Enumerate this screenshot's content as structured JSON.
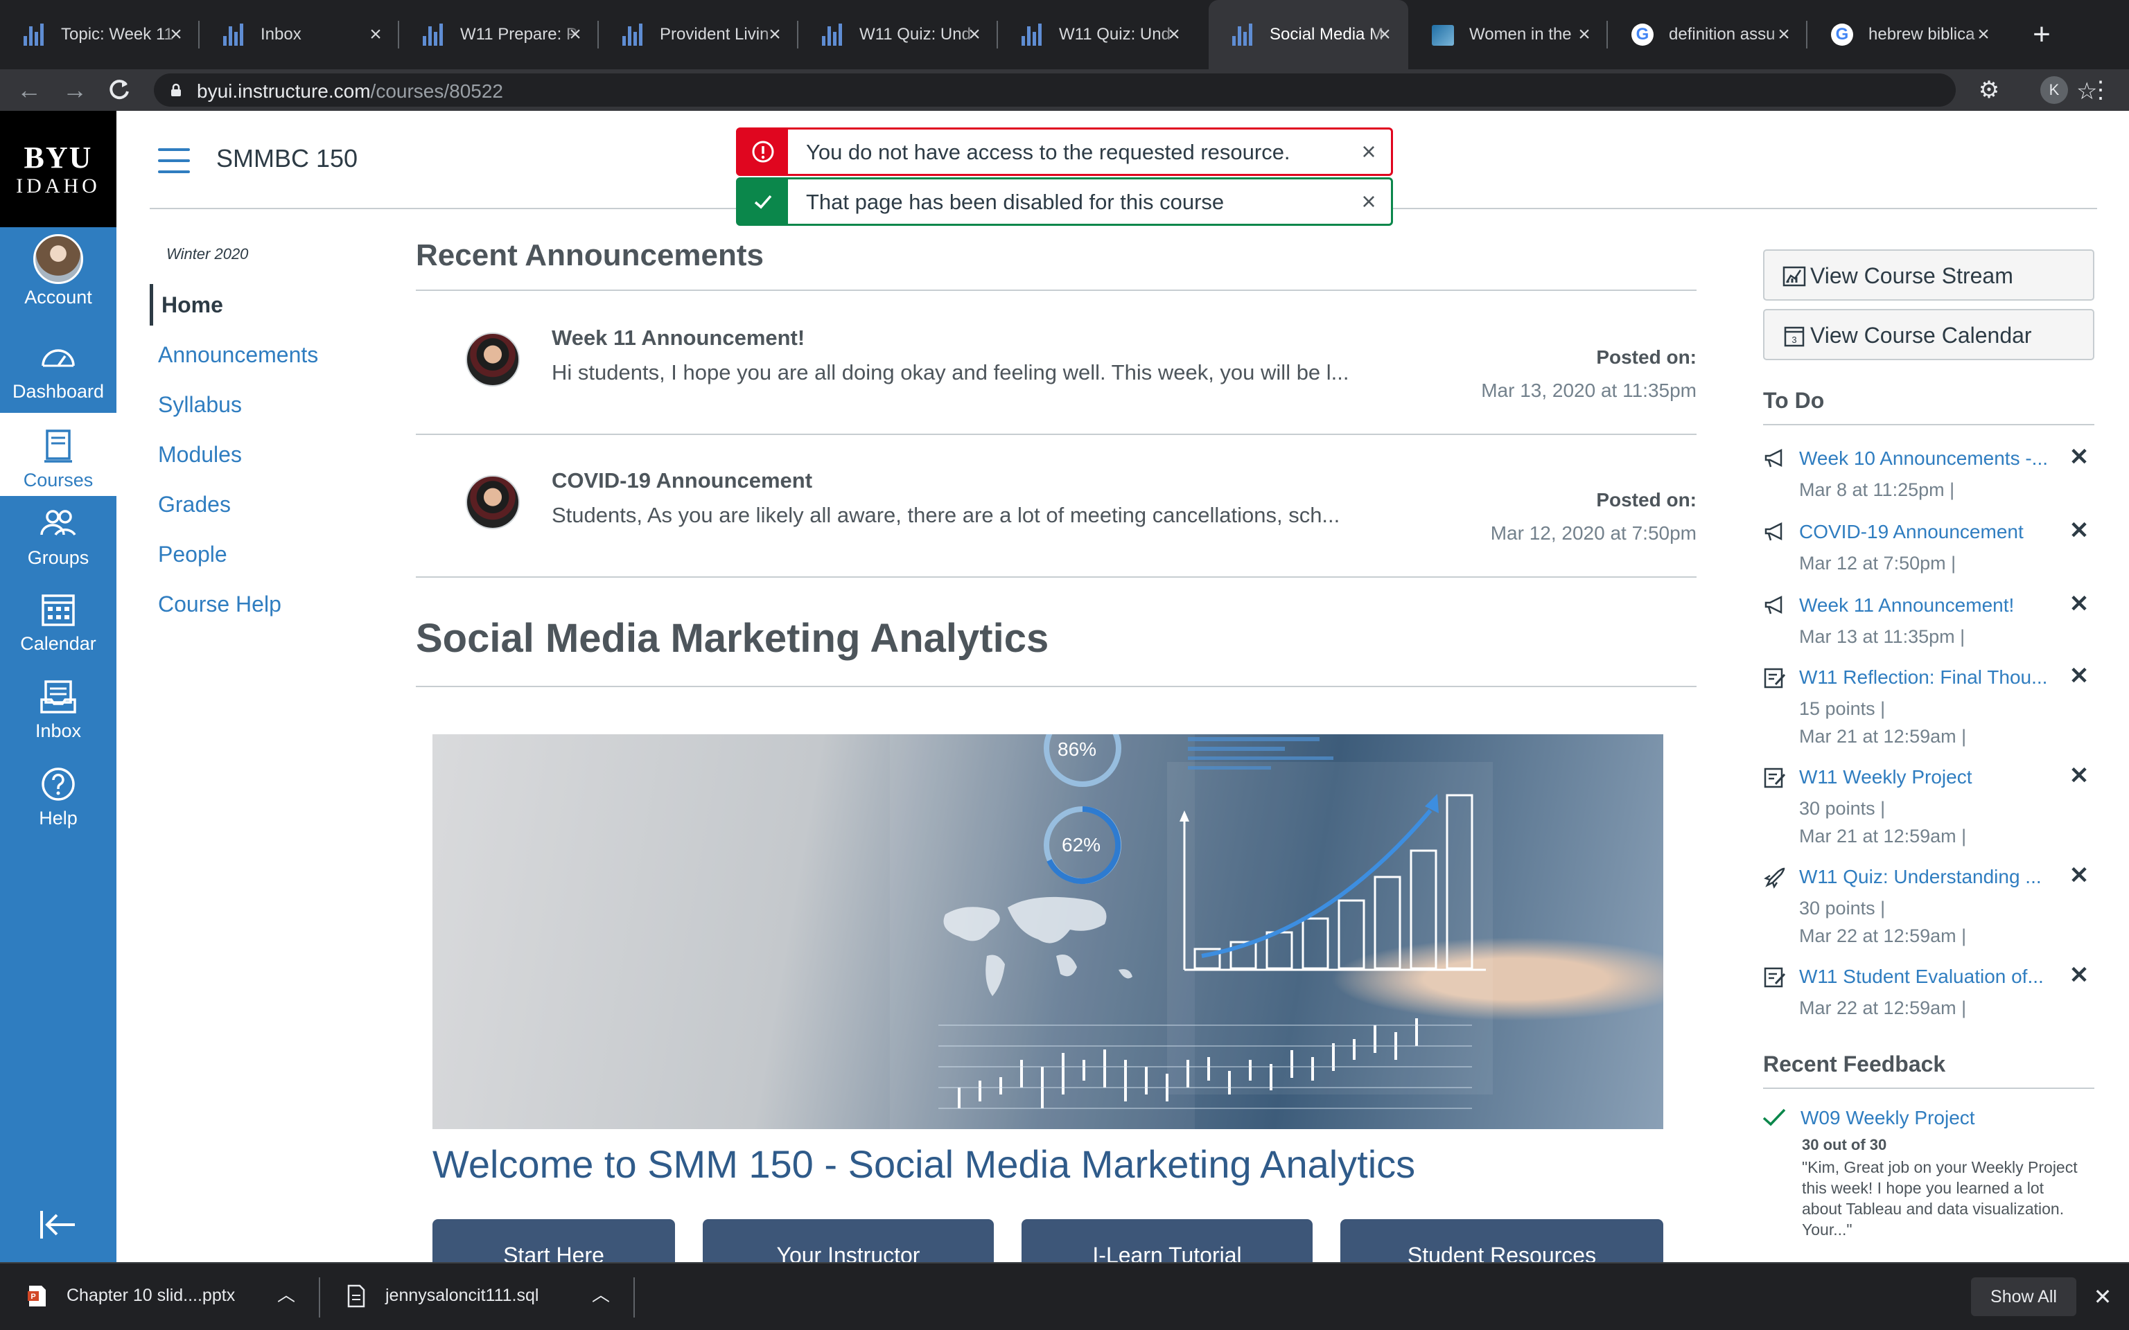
{
  "browser": {
    "tabs": [
      {
        "title": "Topic: Week 11",
        "icon": "canvas-icon"
      },
      {
        "title": "Inbox",
        "icon": "canvas-icon"
      },
      {
        "title": "W11 Prepare: P",
        "icon": "canvas-icon"
      },
      {
        "title": "Provident Livin",
        "icon": "canvas-icon"
      },
      {
        "title": "W11 Quiz: Und",
        "icon": "canvas-icon"
      },
      {
        "title": "W11 Quiz: Und",
        "icon": "canvas-icon"
      },
      {
        "title": "Social Media M",
        "icon": "canvas-icon",
        "active": true
      },
      {
        "title": "Women in the",
        "icon": "image-icon"
      },
      {
        "title": "definition assu",
        "icon": "google-icon"
      },
      {
        "title": "hebrew biblica",
        "icon": "google-icon"
      }
    ],
    "url_host": "byui.instructure.com",
    "url_path": "/courses/80522",
    "profile_initial": "K"
  },
  "global_nav": {
    "logo_line1": "BYU",
    "logo_line2": "IDAHO",
    "items": [
      {
        "label": "Account",
        "icon": "avatar"
      },
      {
        "label": "Dashboard",
        "icon": "dashboard-icon"
      },
      {
        "label": "Courses",
        "icon": "courses-icon",
        "active": true
      },
      {
        "label": "Groups",
        "icon": "groups-icon"
      },
      {
        "label": "Calendar",
        "icon": "calendar-icon"
      },
      {
        "label": "Inbox",
        "icon": "inbox-icon"
      },
      {
        "label": "Help",
        "icon": "help-icon"
      }
    ]
  },
  "course": {
    "code": "SMMBC 150",
    "term": "Winter 2020",
    "nav": [
      "Home",
      "Announcements",
      "Syllabus",
      "Modules",
      "Grades",
      "People",
      "Course Help"
    ]
  },
  "flash": {
    "error": "You do not have access to the requested resource.",
    "success": "That page has been disabled for this course"
  },
  "announcements": {
    "heading": "Recent Announcements",
    "posted_label": "Posted on:",
    "items": [
      {
        "title": "Week 11 Announcement!",
        "message": "Hi students,  I hope you are all doing okay and feeling well. This week, you will be l...",
        "date": "Mar 13, 2020 at 11:35pm"
      },
      {
        "title": "COVID-19 Announcement",
        "message": "Students,  As you are likely all aware, there are a lot of meeting cancellations, sch...",
        "date": "Mar 12, 2020 at 7:50pm"
      }
    ]
  },
  "main": {
    "course_heading": "Social Media Marketing Analytics",
    "banner_stats": [
      "86%",
      "62%"
    ],
    "welcome": "Welcome to SMM 150 - Social Media Marketing Analytics",
    "buttons": [
      "Start Here",
      "Your Instructor",
      "I-Learn Tutorial",
      "Student Resources"
    ]
  },
  "sidebar": {
    "view_stream": "View Course Stream",
    "view_calendar": "View Course Calendar",
    "todo_heading": "To Do",
    "todo": [
      {
        "title": "Week 10 Announcements -...",
        "type": "announcement",
        "meta": [
          "Mar 8 at 11:25pm  |"
        ]
      },
      {
        "title": "COVID-19 Announcement",
        "type": "announcement",
        "meta": [
          "Mar 12 at 7:50pm  |"
        ]
      },
      {
        "title": "Week 11 Announcement!",
        "type": "announcement",
        "meta": [
          "Mar 13 at 11:35pm  |"
        ]
      },
      {
        "title": "W11 Reflection: Final Thou...",
        "type": "assignment",
        "meta": [
          "15 points  |",
          "Mar 21 at 12:59am  |"
        ]
      },
      {
        "title": "W11 Weekly Project",
        "type": "assignment",
        "meta": [
          "30 points  |",
          "Mar 21 at 12:59am  |"
        ]
      },
      {
        "title": "W11 Quiz: Understanding ...",
        "type": "quiz",
        "meta": [
          "30 points  |",
          "Mar 22 at 12:59am  |"
        ]
      },
      {
        "title": "W11 Student Evaluation of...",
        "type": "assignment",
        "meta": [
          "Mar 22 at 12:59am  |"
        ]
      }
    ],
    "feedback_heading": "Recent Feedback",
    "feedback": {
      "title": "W09 Weekly Project",
      "score": "30 out of 30",
      "comment": "\"Kim, Great job on your Weekly Project this week! I hope you learned a lot about Tableau and data visualization. Your...\""
    }
  },
  "downloads": {
    "items": [
      "Chapter 10 slid....pptx",
      "jennysaloncit111.sql"
    ],
    "show_all": "Show All"
  },
  "colors": {
    "brand_blue": "#2f7dc0",
    "error_red": "#e0061f",
    "success_green": "#0b874b",
    "button_navy": "#3d5678"
  }
}
